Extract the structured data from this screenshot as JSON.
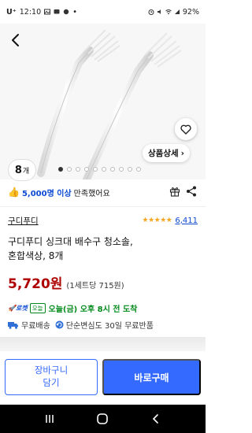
{
  "status_bar": {
    "carrier": "U⁺",
    "time": "12:10",
    "battery": "92%"
  },
  "product_image": {
    "pager_total": 10,
    "pager_active": 1
  },
  "badge": {
    "count": "8",
    "unit": "개"
  },
  "detail_button": {
    "label": "상품상세",
    "chevron": "›"
  },
  "promo": {
    "highlight": "5,000명 이상",
    "rest": "만족했어요"
  },
  "brand": {
    "name": "구디푸디"
  },
  "rating": {
    "stars": 4.5,
    "review_count": "6,411"
  },
  "product": {
    "title_line1": "구디푸디 싱크대 배수구 청소솔,",
    "title_line2": "혼합색상, 8개",
    "price": "5,720원",
    "unit_price": "(1세트당 715원)"
  },
  "delivery": {
    "rocket": "로켓",
    "today_tag": "오늘",
    "text": "오늘(금) 오후 8시 전 도착"
  },
  "shipping": {
    "free": "무료배송",
    "returns": "단순변심도 30일 무료반품"
  },
  "actions": {
    "cart_label": "장바구니 담기",
    "buy_label": "바로구매"
  },
  "colors": {
    "accent": "#346aff",
    "price": "#ae0000",
    "delivery": "#00891a",
    "star": "#f5a623"
  }
}
